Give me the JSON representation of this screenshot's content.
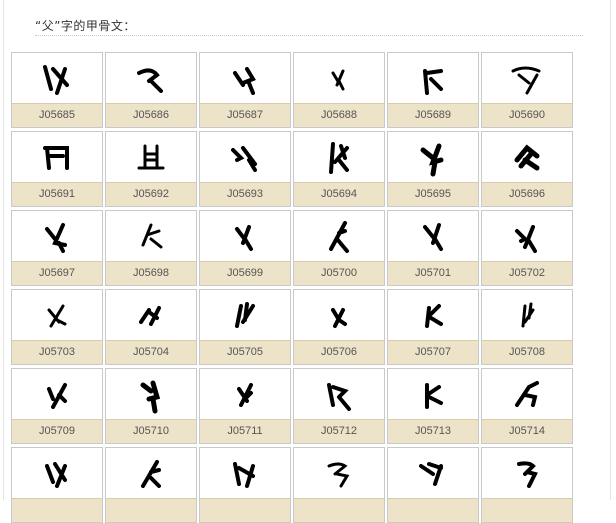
{
  "heading": "“父”字的甲骨文：",
  "colors": {
    "label_bg": "#ede3c8",
    "border": "#c9c9c9",
    "glyph": "#000000"
  },
  "entries": [
    "J05685",
    "J05686",
    "J05687",
    "J05688",
    "J05689",
    "J05690",
    "J05691",
    "J05692",
    "J05693",
    "J05694",
    "J05695",
    "J05696",
    "J05697",
    "J05698",
    "J05699",
    "J05700",
    "J05701",
    "J05702",
    "J05703",
    "J05704",
    "J05705",
    "J05706",
    "J05707",
    "J05708",
    "J05709",
    "J05710",
    "J05711",
    "J05712",
    "J05713",
    "J05714",
    "",
    "",
    "",
    "",
    "",
    ""
  ]
}
